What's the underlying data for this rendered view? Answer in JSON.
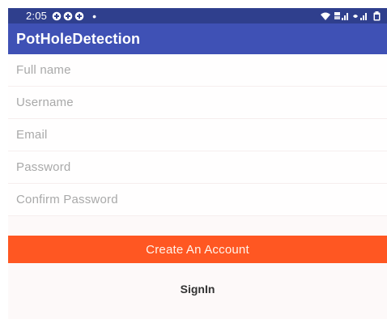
{
  "status_bar": {
    "time": "2:05",
    "dot": "•",
    "notification_icons": [
      "dual-app-icon",
      "dual-app-icon",
      "dual-app-icon"
    ],
    "system_icons": [
      "wifi-icon",
      "volte-signal-icon",
      "signal-icon",
      "battery-icon"
    ]
  },
  "app_bar": {
    "title": "PotHoleDetection"
  },
  "form": {
    "full_name_placeholder": "Full name",
    "username_placeholder": "Username",
    "email_placeholder": "Email",
    "password_placeholder": "Password",
    "confirm_password_placeholder": "Confirm Password"
  },
  "actions": {
    "create_account_label": "Create An Account",
    "signin_label": "SignIn"
  },
  "colors": {
    "status_bar": "#2f3f8d",
    "app_bar": "#3f51b5",
    "primary_button": "#ff5722",
    "background": "#fdf9f9"
  }
}
